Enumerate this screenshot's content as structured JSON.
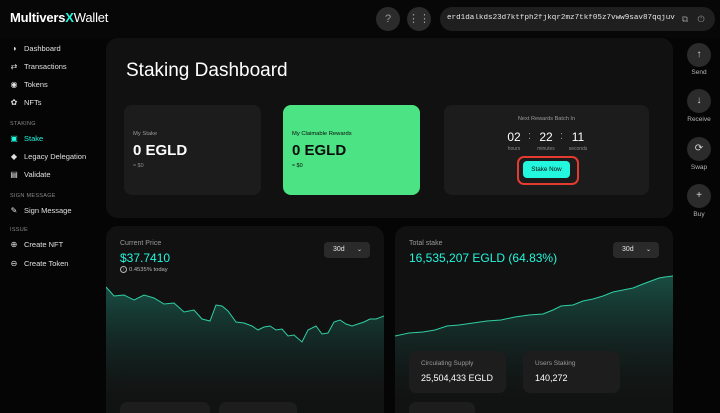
{
  "brand": {
    "part1": "Multivers",
    "accent": "X",
    "part2": "Wallet"
  },
  "header": {
    "help_glyph": "?",
    "apps_glyph": "⋮⋮",
    "address": "erd1dalkds23d7ktfph2fjkqr2mz7tkf05z7vww9sav87qqjuvrmyhssmrjvv",
    "copy_glyph": "⧉",
    "power_glyph": "⏻"
  },
  "sidebar": {
    "items": [
      {
        "label": "Dashboard",
        "icon": "dashboard-icon",
        "glyph": "◑"
      },
      {
        "label": "Transactions",
        "icon": "transactions-icon",
        "glyph": "⇄"
      },
      {
        "label": "Tokens",
        "icon": "tokens-icon",
        "glyph": "◉"
      },
      {
        "label": "NFTs",
        "icon": "nfts-icon",
        "glyph": "✿"
      }
    ],
    "staking_section": "STAKING",
    "staking_items": [
      {
        "label": "Stake",
        "icon": "lock-icon",
        "glyph": "▣",
        "active": true
      },
      {
        "label": "Legacy Delegation",
        "icon": "delegation-icon",
        "glyph": "◆"
      },
      {
        "label": "Validate",
        "icon": "validate-icon",
        "glyph": "▤"
      }
    ],
    "sign_section": "SIGN MESSAGE",
    "sign_items": [
      {
        "label": "Sign Message",
        "icon": "sign-icon",
        "glyph": "✎"
      }
    ],
    "issue_section": "ISSUE",
    "issue_items": [
      {
        "label": "Create NFT",
        "icon": "create-nft-icon",
        "glyph": "⊕"
      },
      {
        "label": "Create Token",
        "icon": "create-token-icon",
        "glyph": "⊖"
      }
    ]
  },
  "dashboard": {
    "title": "Staking Dashboard",
    "my_stake": {
      "label": "My Stake",
      "value": "0 EGLD",
      "sub": "≈ $0"
    },
    "claimable": {
      "label": "My Claimable Rewards",
      "value": "0 EGLD",
      "sub": "≈ $0"
    },
    "rewards": {
      "label": "Next Rewards Batch In",
      "hours": "02",
      "minutes": "22",
      "seconds": "11",
      "hours_label": "hours",
      "minutes_label": "minutes",
      "seconds_label": "seconds",
      "separator": ":",
      "stake_button": "Stake Now"
    }
  },
  "price_panel": {
    "label": "Current Price",
    "value": "$37.7410",
    "change": "0.4535% today",
    "range": "30d",
    "chevron": "⌄",
    "up_glyph": "↑"
  },
  "stake_panel": {
    "label": "Total stake",
    "value": "16,535,207 EGLD (64.83%)",
    "range": "30d",
    "chevron": "⌄",
    "circulating_label": "Circulating Supply",
    "circulating_value": "25,504,433 EGLD",
    "users_label": "Users Staking",
    "users_value": "140,272"
  },
  "rail": {
    "send": "Send",
    "send_glyph": "↑",
    "receive": "Receive",
    "receive_glyph": "↓",
    "swap": "Swap",
    "swap_glyph": "⟳",
    "buy": "Buy",
    "buy_glyph": "+"
  },
  "colors": {
    "accent": "#23f7dd",
    "green_card": "#4be383",
    "highlight": "#e33b2f"
  }
}
